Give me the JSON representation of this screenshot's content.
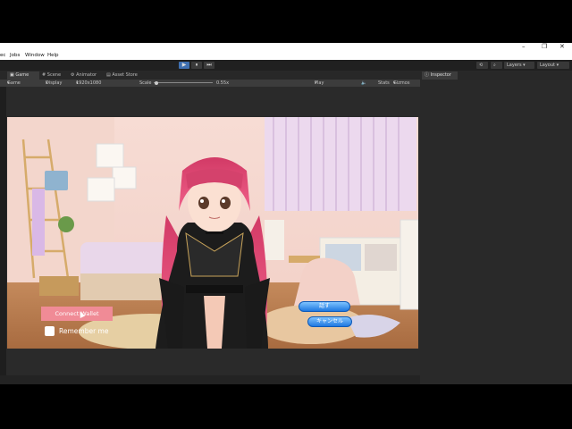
{
  "menu": {
    "items": [
      "ec",
      "Jobs",
      "Window",
      "Help"
    ]
  },
  "window_controls": {
    "minimize": "–",
    "maximize": "❐",
    "close": "✕"
  },
  "toolbar": {
    "play": "▶",
    "pause": "⏸",
    "step": "⏭",
    "layers_label": "Layers",
    "layout_label": "Layout"
  },
  "tabs": [
    {
      "label": "Game",
      "icon": "gamepad-icon"
    },
    {
      "label": "Scene",
      "icon": "grid-icon"
    },
    {
      "label": "Animator",
      "icon": "animator-icon"
    },
    {
      "label": "Asset Store",
      "icon": "store-icon"
    }
  ],
  "inspector": {
    "label": "Inspector"
  },
  "game_toolbar": {
    "mode": "Game",
    "display": "Display 1",
    "resolution": "1920x1080",
    "scale_label": "Scale",
    "scale_value": "0.55x",
    "play_mode": "Play Focused",
    "stats": "Stats",
    "gizmos": "Gizmos"
  },
  "game_ui": {
    "connect_wallet": "Connect Wallet",
    "remember_me": "Remember me",
    "talk_button": "話す",
    "cancel_button": "キャンセル"
  },
  "colors": {
    "editor_bg": "#282828",
    "play_active": "#3f6fb0",
    "connect_button": "#f08b96",
    "hair": "#e0436e"
  }
}
